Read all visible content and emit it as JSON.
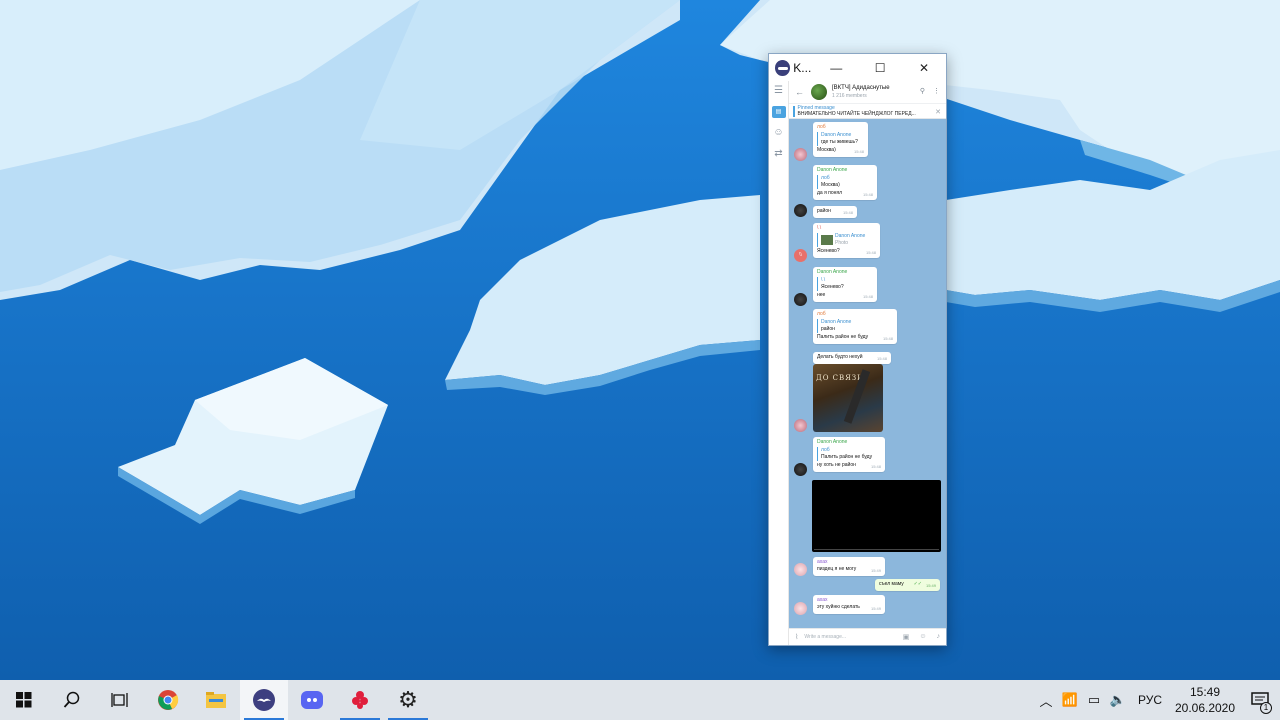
{
  "window": {
    "title": "K...",
    "controls": {
      "minimize": "—",
      "maximize": "☐",
      "close": "✕"
    }
  },
  "chat": {
    "name": "[ВКТЧ] Адидаснутые",
    "members": "1 216 members",
    "pinned": {
      "title": "Pinned message",
      "text": "ВНИМАТЕЛЬНО ЧИТАЙТЕ ЧЕЙНДЖЛОГ ПЕРЕД..."
    },
    "composer_placeholder": "Write a message..."
  },
  "messages": [
    {
      "sender": "лоб",
      "quote_sender": "Danon Anone",
      "quote_text": "где ты живешь?",
      "text": "Москва)",
      "time": "15:48"
    },
    {
      "sender": "Danon Anone",
      "quote_sender": "лоб",
      "quote_text": "Москва)",
      "text": "да я понял",
      "time": "15:48"
    },
    {
      "text": "район",
      "time": "15:48"
    },
    {
      "sender": "\\ \\",
      "quote_sender": "Danon Anone",
      "quote_text": "Photo",
      "text": "Ясенево?",
      "time": "15:48"
    },
    {
      "sender": "Danon Anone",
      "quote_sender": "\\ \\",
      "quote_text": "Ясенево?",
      "text": "нее",
      "time": "15:48"
    },
    {
      "sender": "лоб",
      "quote_sender": "Danon Anone",
      "quote_text": "район",
      "text": "Палить район не буду",
      "time": "15:48"
    },
    {
      "text": "Делать будто нехуй",
      "time": "15:48"
    },
    {
      "image_caption": "ДО СВЯЗИ"
    },
    {
      "sender": "Danon Anone",
      "quote_sender": "лоб",
      "quote_text": "Палить район не буду",
      "text": "ну хоть не район",
      "time": "15:48"
    },
    {
      "sender": "ахах",
      "text": "пиздец я не могу",
      "time": "15:49"
    },
    {
      "text": "съел маму",
      "time": "15:49",
      "outgoing": true
    },
    {
      "sender": "ахах",
      "text": "эту хуйню сделать",
      "time": "15:49"
    }
  ],
  "taskbar": {
    "apps": [
      "start-button",
      "search",
      "task-view",
      "chrome",
      "file-explorer",
      "telegram",
      "discord",
      "app-red",
      "settings"
    ],
    "language": "РУС",
    "time": "15:49",
    "date": "20.06.2020",
    "notification_count": "1"
  },
  "colors": {
    "chat_bg": "#8cb7dc",
    "accent": "#4aa3e0",
    "taskbar_bg": "#dfe4ea"
  }
}
